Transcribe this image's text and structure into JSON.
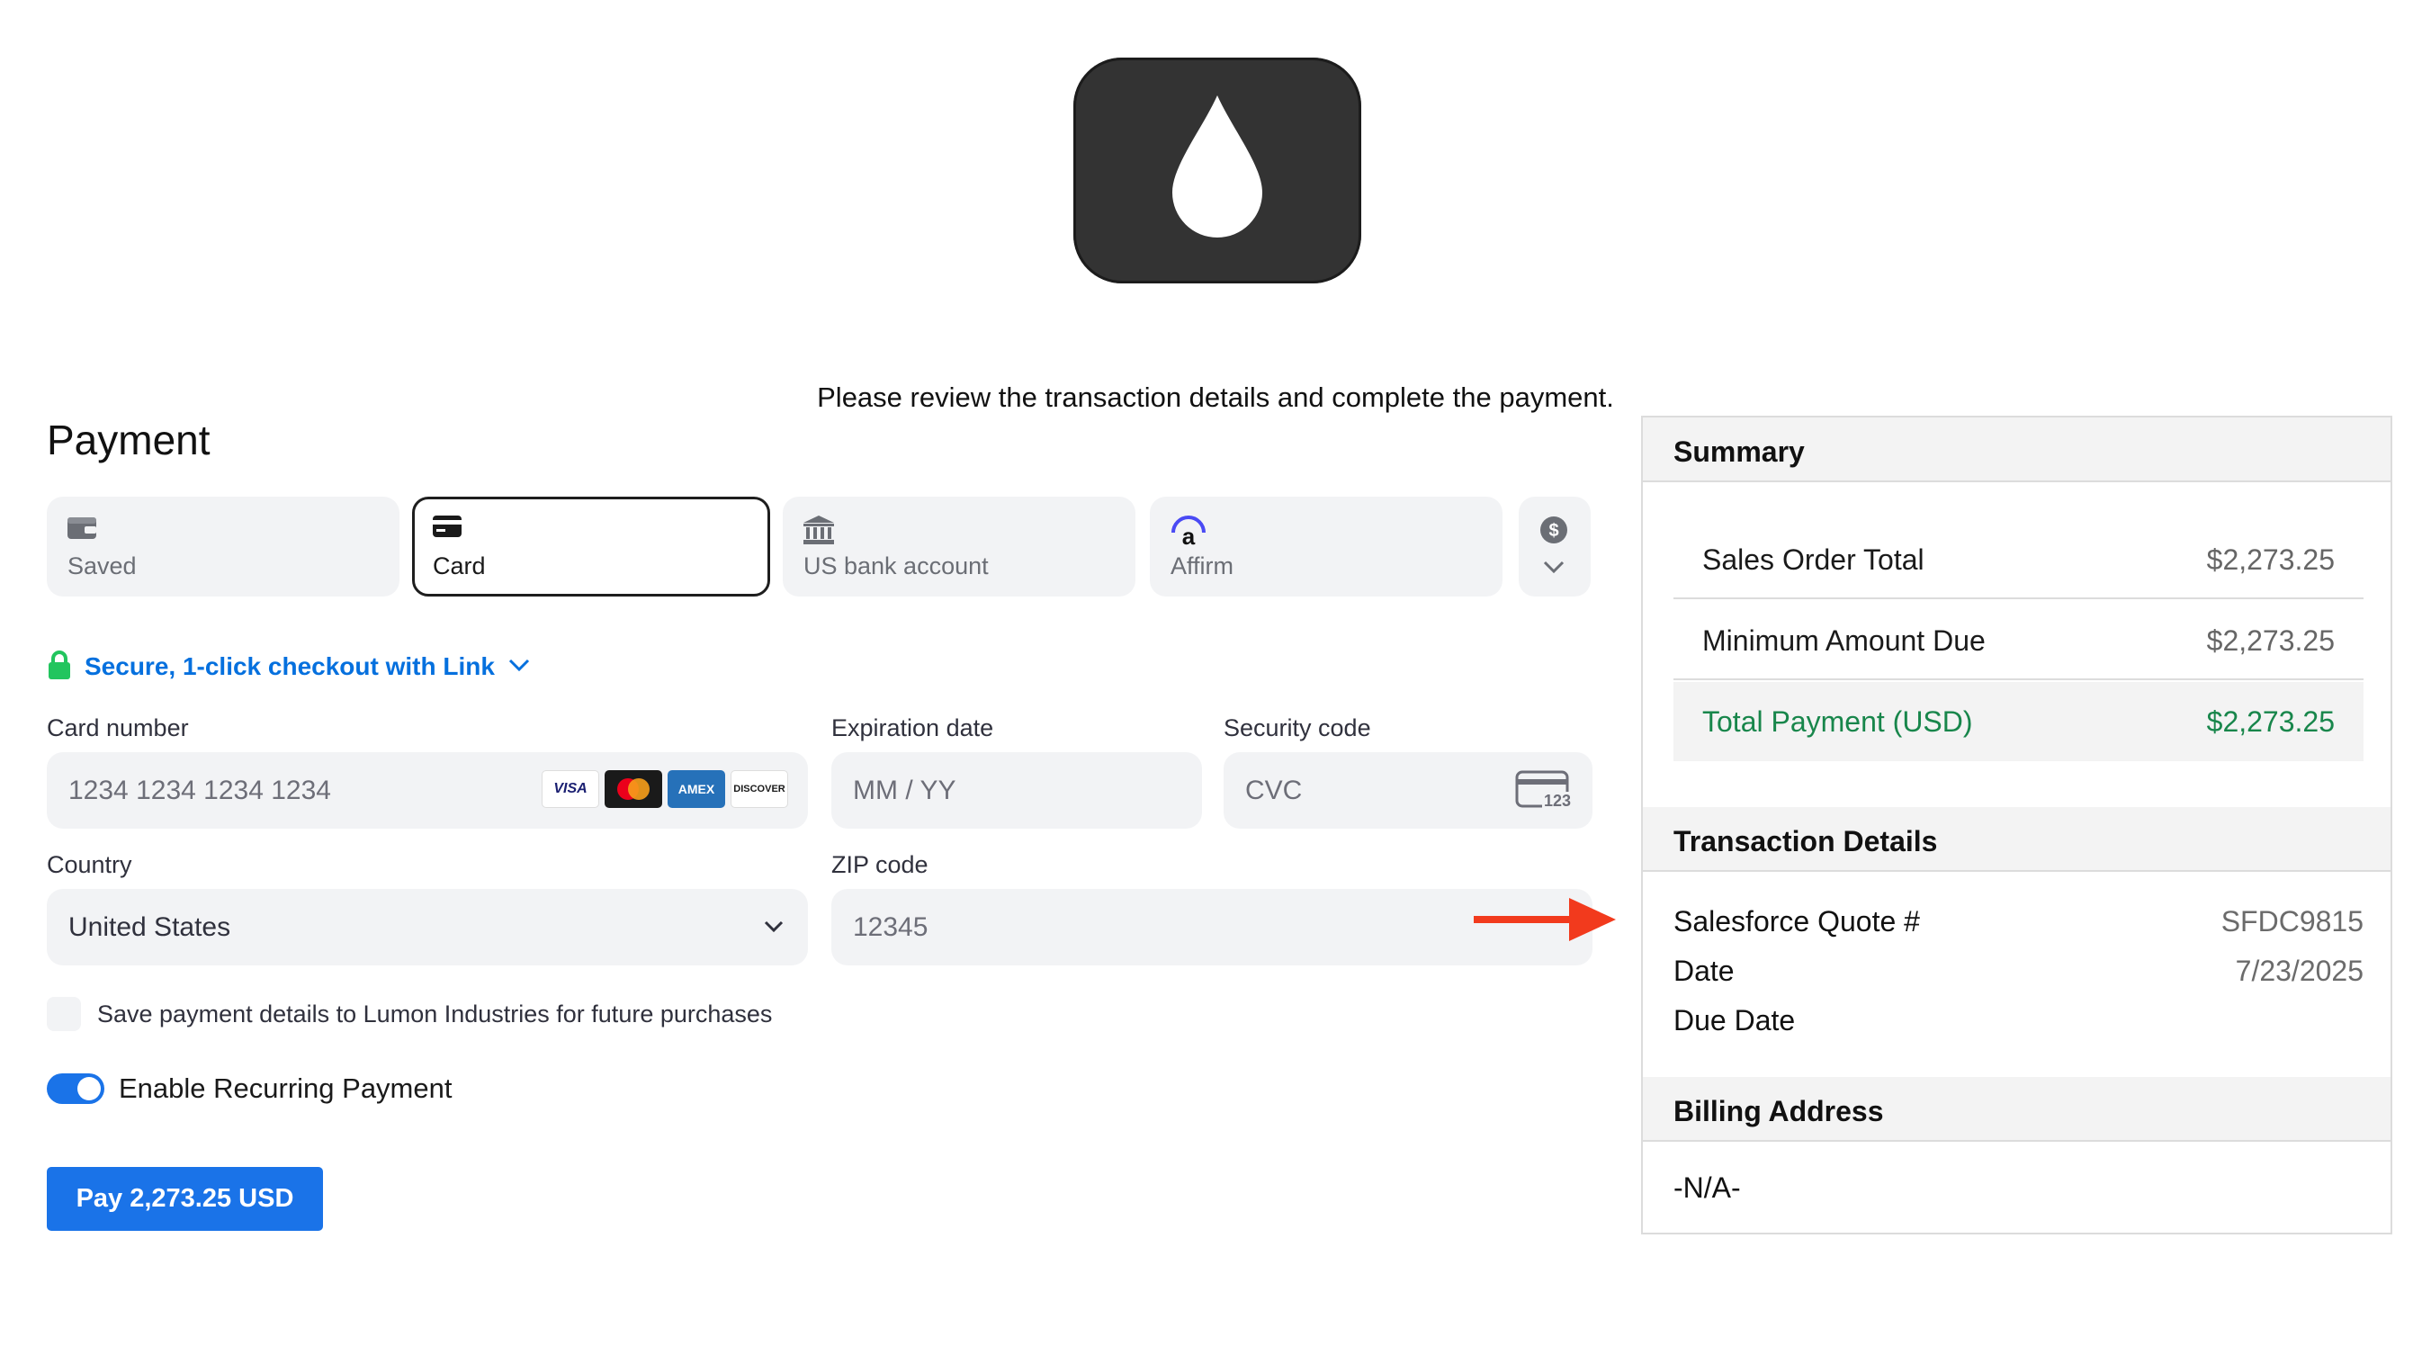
{
  "intro_text": "Please review the transaction details and complete the payment.",
  "payment": {
    "title": "Payment",
    "tabs": [
      {
        "label": "Saved",
        "icon": "wallet-icon",
        "active": false
      },
      {
        "label": "Card",
        "icon": "card-icon",
        "active": true
      },
      {
        "label": "US bank account",
        "icon": "bank-icon",
        "active": false
      },
      {
        "label": "Affirm",
        "icon": "affirm-icon",
        "active": false
      }
    ],
    "link_text": "Secure, 1-click checkout with Link",
    "card_number": {
      "label": "Card number",
      "placeholder": "1234 1234 1234 1234"
    },
    "card_brands": [
      "VISA",
      "Mastercard",
      "AMEX",
      "DISCOVER"
    ],
    "expiration": {
      "label": "Expiration date",
      "placeholder": "MM / YY"
    },
    "security": {
      "label": "Security code",
      "placeholder": "CVC",
      "icon_text": "123"
    },
    "country": {
      "label": "Country",
      "value": "United States"
    },
    "zip": {
      "label": "ZIP code",
      "placeholder": "12345"
    },
    "save_details_text": "Save payment details to Lumon Industries for future purchases",
    "recurring_text": "Enable Recurring Payment",
    "recurring_enabled": true,
    "pay_button": "Pay 2,273.25 USD"
  },
  "summary": {
    "title": "Summary",
    "rows": [
      {
        "label": "Sales Order Total",
        "value": "$2,273.25"
      },
      {
        "label": "Minimum Amount Due",
        "value": "$2,273.25"
      },
      {
        "label": "Total Payment (USD)",
        "value": "$2,273.25"
      }
    ]
  },
  "transaction": {
    "title": "Transaction Details",
    "rows": [
      {
        "label": "Salesforce Quote #",
        "value": "SFDC9815"
      },
      {
        "label": "Date",
        "value": "7/23/2025"
      },
      {
        "label": "Due Date",
        "value": ""
      }
    ]
  },
  "billing": {
    "title": "Billing Address",
    "value": "-N/A-"
  },
  "colors": {
    "accent": "#1a73e8",
    "link": "#0570de",
    "total_green": "#18864b",
    "annotation_arrow": "#f23a1d",
    "logo_bg": "#333333"
  }
}
